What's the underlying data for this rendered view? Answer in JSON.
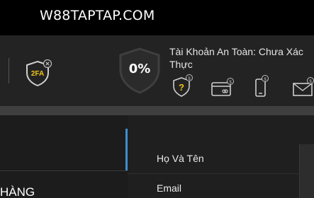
{
  "header": {
    "brand": "W88TAPTAP.COM"
  },
  "security": {
    "twofa_badge": "2FA",
    "score": "0%",
    "status_text": "Tài Khoản An Toàn: Chưa Xác Thực",
    "methods": [
      {
        "name": "security-question",
        "icon": "question-shield-icon"
      },
      {
        "name": "bank-card",
        "icon": "card-icon"
      },
      {
        "name": "phone",
        "icon": "phone-icon"
      },
      {
        "name": "email",
        "icon": "mail-icon"
      }
    ]
  },
  "sidebar": {
    "partial_label": "HÀNG"
  },
  "form": {
    "fields": [
      {
        "label": "Họ Và Tên"
      },
      {
        "label": "Email"
      }
    ]
  },
  "colors": {
    "accent": "#3d8fd1",
    "badge_yellow": "#f0c419",
    "background": "#2b2b2b"
  }
}
